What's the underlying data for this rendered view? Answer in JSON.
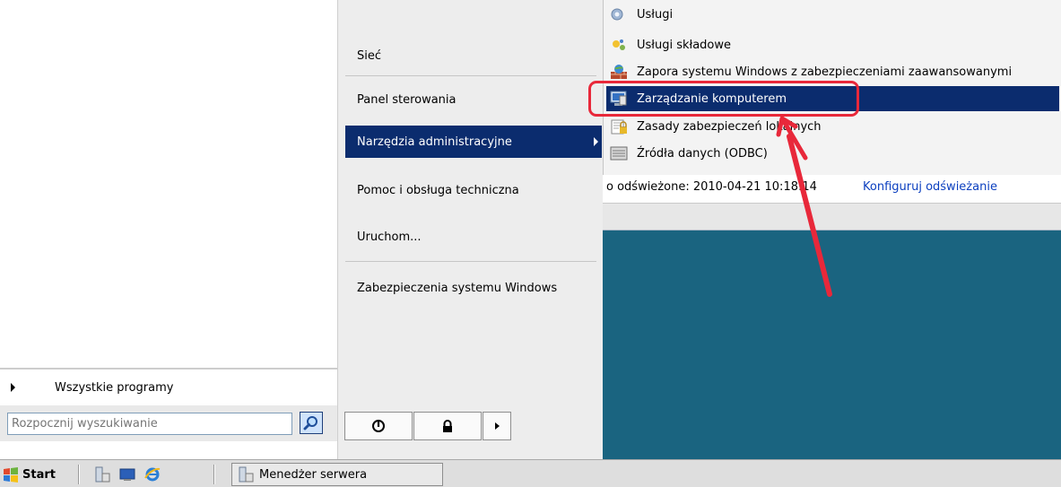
{
  "start_menu": {
    "all_programs_label": "Wszystkie programy",
    "search_placeholder": "Rozpocznij wyszukiwanie",
    "right_column": {
      "items": [
        {
          "label": "Sieć"
        },
        {
          "label": "Panel sterowania"
        },
        {
          "label": "Narzędzia administracyjne"
        },
        {
          "label": "Pomoc i obsługa techniczna"
        },
        {
          "label": "Uruchom..."
        },
        {
          "label": "Zabezpieczenia systemu Windows"
        }
      ],
      "selected_index": 2
    },
    "power_buttons": [
      "power-icon",
      "lock-icon",
      "arrow-right-icon"
    ]
  },
  "admin_tools_submenu": {
    "items": [
      {
        "label": "Usługi",
        "icon": "services-gear-icon"
      },
      {
        "label": "Usługi składowe",
        "icon": "component-services-icon"
      },
      {
        "label": "Zapora systemu Windows z zabezpieczeniami zaawansowanymi",
        "icon": "firewall-icon"
      },
      {
        "label": "Zarządzanie komputerem",
        "icon": "computer-management-icon"
      },
      {
        "label": "Zasady zabezpieczeń lokalnych",
        "icon": "security-policy-icon"
      },
      {
        "label": "Źródła danych (ODBC)",
        "icon": "odbc-icon"
      }
    ],
    "highlighted_index": 3
  },
  "background_window": {
    "status_text": "o odświeżone: 2010-04-21 10:18:14",
    "status_link": "Konfiguruj odświeżanie"
  },
  "taskbar": {
    "start_label": "Start",
    "quick_launch": [
      "server-manager-icon",
      "show-desktop-icon",
      "internet-explorer-icon"
    ],
    "open_window_label": "Menedżer serwera"
  },
  "colors": {
    "selection": "#0b2c6e",
    "annotation": "#e8283a",
    "background_app": "#1a6480"
  }
}
